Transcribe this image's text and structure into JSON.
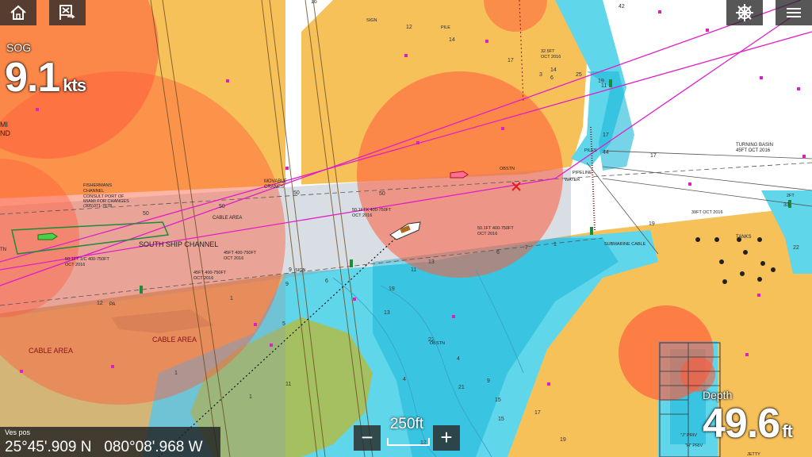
{
  "toolbar": {
    "home_icon": "home-icon",
    "waypoint_icon": "waypoint-flag-icon",
    "helm_icon": "ship-wheel-icon",
    "menu_icon": "hamburger-menu-icon"
  },
  "sog": {
    "label": "SOG",
    "value": "9.1",
    "unit": "kts"
  },
  "depth": {
    "label": "Depth",
    "value": "49.6",
    "unit": "ft"
  },
  "vessel_position": {
    "label": "Ves pos",
    "lat": "25°45'.909 N",
    "lon": "080°08'.968 W"
  },
  "zoom": {
    "scale": "250ft",
    "minus": "−",
    "plus": "+"
  },
  "chart_labels": {
    "south_ship_channel": "SOUTH SHIP CHANNEL",
    "cable_area_1": "CABLE AREA",
    "cable_area_2": "CABLE AREA",
    "cable_area_3": "CABLE AREA",
    "fishermans_1": "FISHERMANS",
    "fishermans_2": "CHANNEL",
    "fishermans_3": "CONSULT PORT OF",
    "fishermans_4": "MIAMI FOR CHANGES",
    "fishermans_5": "(305)371-7678",
    "movable_cranes_1": "MOVABLE",
    "movable_cranes_2": "CRANES",
    "turning_basin_1": "TURNING BASIN",
    "turning_basin_2": "45FT OCT 2016",
    "tanks": "TANKS",
    "pipeline_1": "PIPELINE",
    "pipeline_2": "WATER",
    "piles": "PILES",
    "pile": "PILE",
    "sign_top": "SIGN",
    "sign_mid": "SIGN",
    "submarine_cable": "SUBMARINE CABLE",
    "obstn_1": "OBSTN",
    "obstn_2": "OBSTN",
    "jetty": "JETTY",
    "depth_32ft_1": "32.5FT",
    "depth_32ft_2": "OCT 2016",
    "depth_50_a1": "50.1FTX 400-750FT",
    "depth_50_a2": "OCT 2016",
    "depth_50_b1": "50.1FT 400-750FT",
    "depth_50_b2": "OCT 2016",
    "depth_50_c1": "50.1FT 1/C 400-750FT",
    "depth_50_c2": "OCT 2016",
    "depth_45_a1": "45FT 400-750FT",
    "depth_45_a2": "OCT 2016",
    "depth_45_b1": "45FT 400-750FT",
    "depth_45_b2": "OCT 2016",
    "depth_39ft": "39FT OCT 2016",
    "depth_2ft": "2FT",
    "priv_1": "\"J\" PRIV",
    "priv_2": "\"H\" PRIV",
    "partial_mi_1": "MI",
    "partial_mi_2": "ND",
    "partial_tn": "TN",
    "pa": "PA"
  },
  "soundings": [
    "42",
    "16",
    "12",
    "14",
    "17",
    "14",
    "25",
    "3",
    "6",
    "19",
    "11",
    "17",
    "44",
    "17",
    "50",
    "50",
    "50",
    "50",
    "19",
    "22",
    "33",
    "12",
    "9",
    "11",
    "13",
    "19",
    "13",
    "22",
    "21",
    "15",
    "15",
    "17",
    "19",
    "4",
    "4",
    "9",
    "11",
    "6",
    "7",
    "1",
    "1",
    "1",
    "1",
    "13",
    "5",
    "6",
    "9"
  ],
  "colors": {
    "land": "#f7c15a",
    "deep_water": "#ffffff",
    "shallow_water": "#5fd6ea",
    "very_shallow": "#1ab8d8",
    "drying": "#a4c060",
    "danger_circle": "#ff6a4e",
    "route": "#e01ec8"
  }
}
